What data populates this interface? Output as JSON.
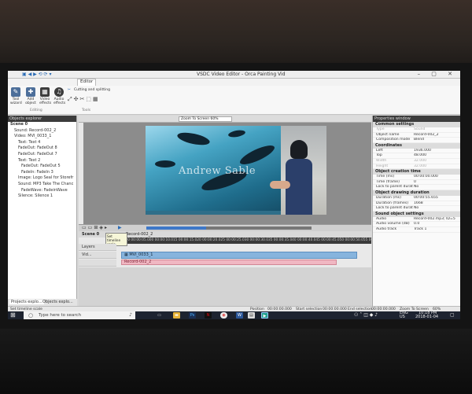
{
  "window": {
    "title": "VSDC Video Editor - Orca Painting Vid",
    "quick_access": "▣ ◀ ▶ ⟲ ⟳ ▾",
    "controls": "– ▢ ✕"
  },
  "tabs": [
    "Editor"
  ],
  "ribbon": {
    "buttons": [
      {
        "label": "Tool wizard"
      },
      {
        "label": "Add object"
      },
      {
        "label": "Video effects"
      },
      {
        "label": "Audio effects"
      }
    ],
    "cutting_label": "Cutting and splitting",
    "groups": [
      "Editing",
      "Tools"
    ]
  },
  "explorer": {
    "title": "Objects explorer",
    "items": [
      "Scene 0",
      "Sound: Record-002_2",
      "Video: MVI_0033_1",
      "Text: Text 4",
      "FadeOut: FadeOut 8",
      "FadeOut: FadeOut 7",
      "Text: Text 2",
      "FadeOut: FadeOut 5",
      "FadeIn: FadeIn 3",
      "Image: Logo Seal for Storefr",
      "Sound: MP3 Take The Chanc",
      "FadeWave: FadeinWave",
      "Silence: Silence 1"
    ],
    "bottom_tabs": [
      "Projects explo...",
      "Objects explo..."
    ]
  },
  "canvas": {
    "zoom_label": "Zoom To Screen  60%",
    "watermark": "Andrew Sable"
  },
  "properties": {
    "title": "Properties window",
    "sections": [
      {
        "head": "Common settings",
        "rows": [
          {
            "k": "Type",
            "v": "Sound",
            "dim": true
          },
          {
            "k": "Object name",
            "v": "Record-002_2"
          },
          {
            "k": "Composition mode",
            "v": "Blend"
          }
        ]
      },
      {
        "head": "Coordinates",
        "rows": [
          {
            "k": "Left",
            "v": "1936.000"
          },
          {
            "k": "Top",
            "v": "48.000"
          },
          {
            "k": "Width",
            "v": "32.000",
            "dim": true
          },
          {
            "k": "Height",
            "v": "32.000",
            "dim": true
          }
        ]
      },
      {
        "head": "Object creation time",
        "rows": [
          {
            "k": "Time (ms)",
            "v": "00:00:00.000"
          },
          {
            "k": "Time (frame)",
            "v": "0"
          },
          {
            "k": "Lock to parent durat",
            "v": "No"
          }
        ]
      },
      {
        "head": "Object drawing duration",
        "rows": [
          {
            "k": "Duration (ms)",
            "v": "00:00:55.655"
          },
          {
            "k": "Duration (frames)",
            "v": "1668"
          },
          {
            "k": "Lock to parent durat",
            "v": "No"
          }
        ]
      },
      {
        "head": "Sound object settings",
        "rows": [
          {
            "k": "Audio",
            "v": "Record-002.mp3; ID=5"
          },
          {
            "k": "Audio volume (dB)",
            "v": "0.0"
          },
          {
            "k": "Audio track",
            "v": "Track 1"
          }
        ]
      }
    ]
  },
  "timeline": {
    "scene_tab": "Scene 0",
    "clip_tab": "Record-002_2",
    "tooltip": "Set timeline scale",
    "ruler": "00.000  00:00:05.000  00:00:10.015  00:00:15.020  00:00:20.025  00:00:25.030  00:00:30.035  00:00:35.040  00:00:40.045  00:00:45.050  00:00:50.055  00:00:55.060",
    "tracks": [
      {
        "label": "Layers"
      },
      {
        "label": "Vid..."
      },
      {
        "label": ""
      }
    ],
    "video_clip": "MVI_0033_1",
    "audio_clip": "Record-002_2",
    "progress": 0.36
  },
  "statusbar": {
    "hint": "Set timeline scale",
    "position_label": "Position",
    "position": "00:00:00.000",
    "start_label": "Start selection",
    "start": "00:00:00.000",
    "end_label": "End selection",
    "end": "00:00:00.000",
    "zoom_label": "Zoom To Screen",
    "zoom": "60%"
  },
  "taskbar": {
    "search_placeholder": "Type here to search",
    "lang": "ENG",
    "region": "US",
    "time": "10:18 PM",
    "date": "2018-01-04"
  }
}
